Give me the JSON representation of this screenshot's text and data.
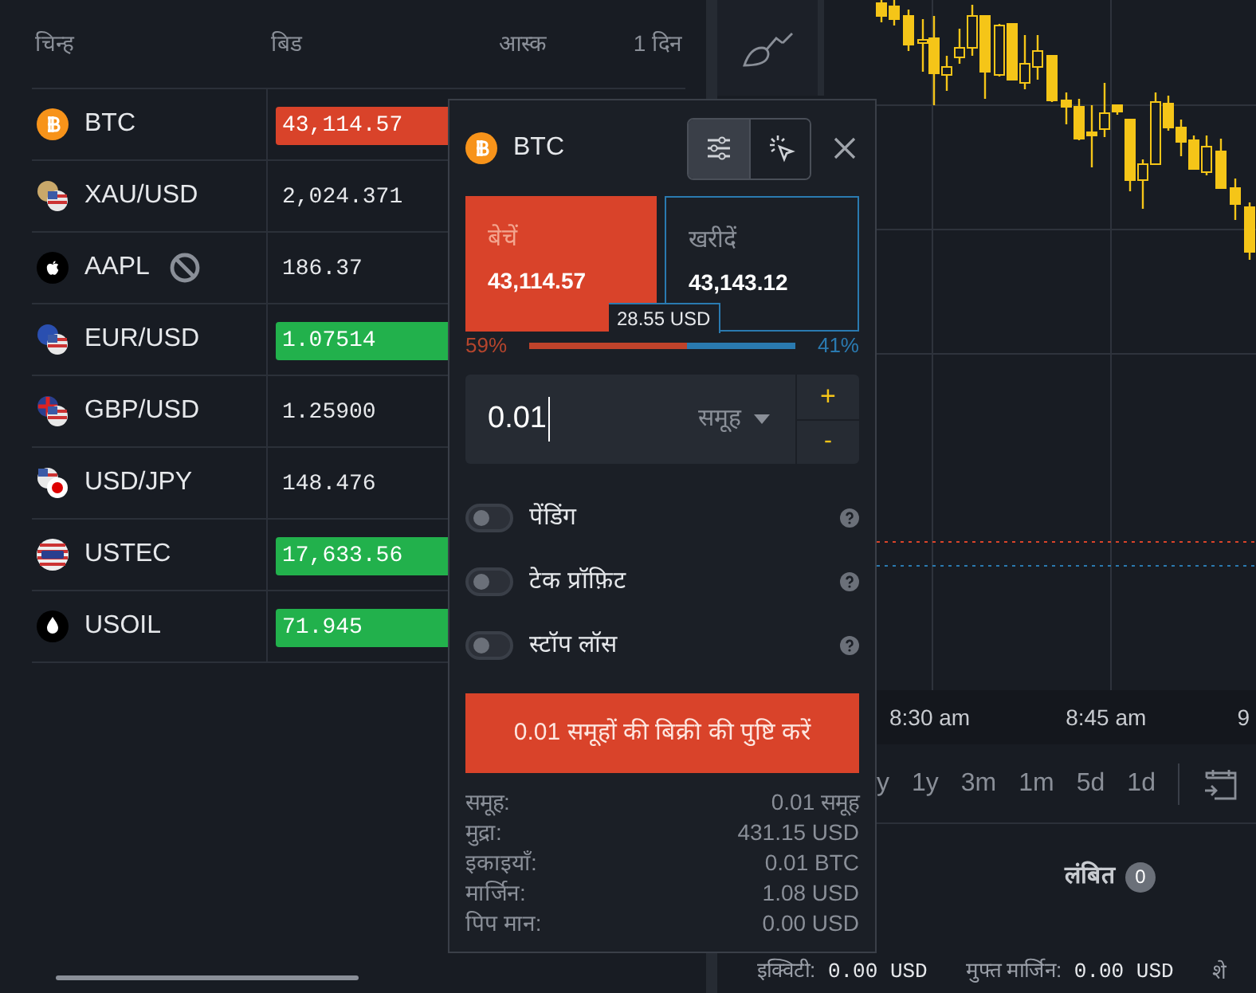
{
  "watchlist": {
    "columns": [
      "चिन्ह",
      "बिड",
      "आस्क",
      "1 दिन"
    ],
    "rows": [
      {
        "symbol": "BTC",
        "kind": "bitcoin",
        "bid": "43,114.57",
        "color": "#d9432a",
        "blocked": false
      },
      {
        "symbol": "XAU/USD",
        "kind": "gold",
        "bid": "2,024.371",
        "blocked": false
      },
      {
        "symbol": "AAPL",
        "kind": "apple",
        "bid": "186.37",
        "blocked": true
      },
      {
        "symbol": "EUR/USD",
        "kind": "euro",
        "bid": "1.07514",
        "color": "#22b14c",
        "blocked": false
      },
      {
        "symbol": "GBP/USD",
        "kind": "pound",
        "bid": "1.25900",
        "blocked": false
      },
      {
        "symbol": "USD/JPY",
        "kind": "yen",
        "bid": "148.476",
        "blocked": false
      },
      {
        "symbol": "USTEC",
        "kind": "index",
        "bid": "17,633.56",
        "color": "#22b14c",
        "blocked": false
      },
      {
        "symbol": "USOIL",
        "kind": "oil",
        "bid": "71.945",
        "color": "#22b14c",
        "blocked": false
      }
    ]
  },
  "order_panel": {
    "symbol": "BTC",
    "mode_buttons": [
      {
        "kind": "sliders",
        "selected": true
      },
      {
        "kind": "pointer",
        "selected": false
      }
    ],
    "sides": [
      {
        "label": "बेचें",
        "price": "43,114.57",
        "selected": true
      },
      {
        "label": "खरीदें",
        "price": "43,143.12",
        "selected": false
      }
    ],
    "spread": "28.55 USD",
    "sentiment": {
      "sell": "59%",
      "buy": "41%",
      "level": 0.59
    },
    "volume": {
      "value": "0.01",
      "unit": "समूह",
      "plus": "+",
      "minus": "-"
    },
    "options": [
      {
        "label": "पेंडिंग",
        "on": false
      },
      {
        "label": "टेक प्रॉफ़िट",
        "on": false
      },
      {
        "label": "स्टॉप लॉस",
        "on": false
      }
    ],
    "confirm_button": "0.01 समूहों की बिक्री की पुष्टि करें",
    "details": [
      {
        "label": "समूह:",
        "value": "0.01 समूह"
      },
      {
        "label": "मुद्रा:",
        "value": "431.15 USD"
      },
      {
        "label": "इकाइयाँ:",
        "value": "0.01 BTC"
      },
      {
        "label": "मार्जिन:",
        "value": "1.08 USD"
      },
      {
        "label": "पिप मान:",
        "value": "0.00 USD"
      }
    ]
  },
  "chart": {
    "time_labels": [
      "8:30 am",
      "8:45 am",
      "9"
    ]
  },
  "timeframes": [
    "y",
    "1y",
    "3m",
    "1m",
    "5d",
    "1d"
  ],
  "positions_tabs": [
    {
      "label": "लंबित",
      "count": "0"
    }
  ],
  "status_bar": [
    {
      "label": "इक्विटी:",
      "value": "0.00 USD"
    },
    {
      "label": "मुफ्त मार्जिन:",
      "value": "0.00 USD"
    },
    {
      "label": "शे"
    }
  ]
}
